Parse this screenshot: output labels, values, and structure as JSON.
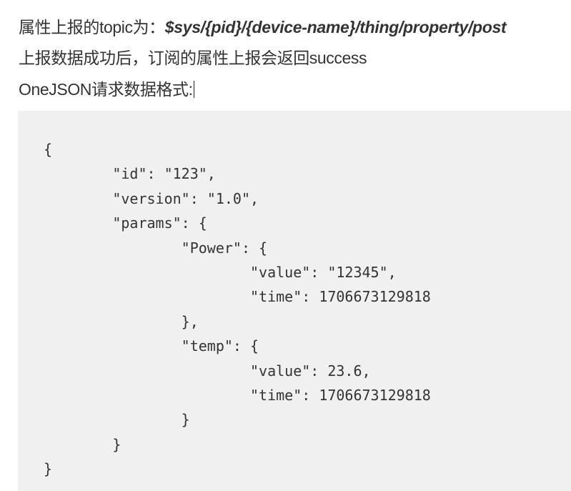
{
  "text": {
    "line1_prefix": "属性上报的topic为：",
    "line1_topic": "$sys/{pid}/{device-name}/thing/property/post",
    "line2": "上报数据成功后，订阅的属性上报会返回success",
    "line3": "OneJSON请求数据格式:"
  },
  "code": {
    "language": "json",
    "content": "{\n\t\"id\": \"123\",\n\t\"version\": \"1.0\",\n\t\"params\": {\n\t\t\"Power\": {\n\t\t\t\"value\": \"12345\",\n\t\t\t\"time\": 1706673129818\n\t\t},\n\t\t\"temp\": {\n\t\t\t\"value\": 23.6,\n\t\t\t\"time\": 1706673129818\n\t\t}\n\t}\n}"
  },
  "colors": {
    "text": "#333333",
    "code_background": "#f0f0f0",
    "page_background": "#ffffff"
  }
}
